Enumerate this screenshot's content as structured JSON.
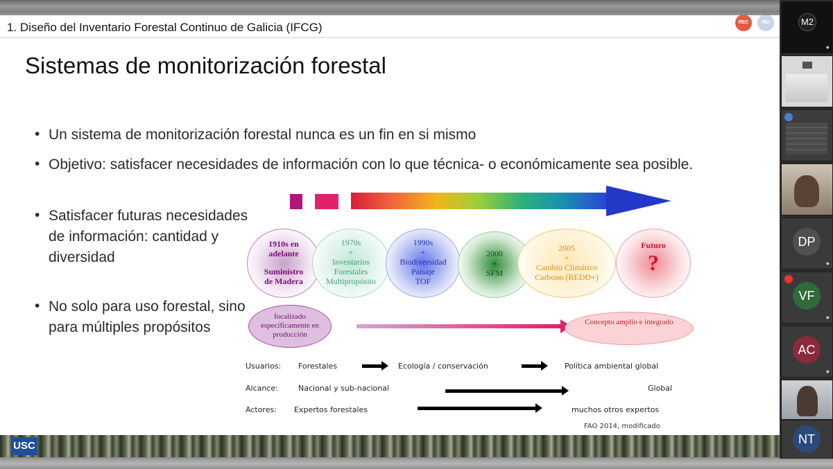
{
  "header": {
    "title": "1. Diseño del Inventario Forestal Continuo de Galicia (IFCG)",
    "rec_badge": "REC",
    "user_badge": "RD"
  },
  "slide": {
    "title": "Sistemas de monitorización forestal",
    "bullets": [
      "Un sistema de monitorización forestal nunca es un fin en si mismo",
      "Objetivo: satisfacer necesidades de información con lo que técnica- o económicamente sea posible.",
      "Satisfacer futuras necesidades de información: cantidad y diversidad",
      "No solo para uso forestal, sino para múltiples propósitos"
    ],
    "circles": [
      {
        "line1": "1910s en",
        "line2": "adelante",
        "line3": "Suministro",
        "line4": "de Madera",
        "color": "#8b1a8b"
      },
      {
        "line1": "1970s",
        "line2": "+",
        "line3": "Inventarios",
        "line4": "Forestales",
        "line5": "Multipropósito",
        "color": "#7fc9a8"
      },
      {
        "line1": "1990s",
        "line2": "+",
        "line3": "Biodiversidad",
        "line4": "Paisaje",
        "line5": "TOF",
        "color": "#2a3fd6"
      },
      {
        "line1": "2000",
        "line2": "+",
        "line3": "SFM",
        "color": "#1f7a2a"
      },
      {
        "line1": "2005",
        "line2": "+",
        "line3": "Cambio Climático",
        "line4": "Carbono (REDD+)",
        "color": "#e6a21a"
      },
      {
        "line1": "Futuro",
        "line2": "?",
        "color": "#d1202f"
      }
    ],
    "focus_left": "focalizado específicamente en producción",
    "focus_right": "Concepto amplio e integrado",
    "rows": [
      {
        "label": "Usuarios:",
        "a": "Forestales",
        "b": "Ecología / conservación",
        "c": "Política ambiental global"
      },
      {
        "label": "Alcance:",
        "a": "Nacional y sub-nacional",
        "c": "Global"
      },
      {
        "label": "Actores:",
        "a": "Expertos forestales",
        "c": "muchos otros expertos"
      }
    ],
    "source": "FAO 2014, modificado",
    "logo": "USC"
  },
  "participants": [
    {
      "initials": "M2",
      "type": "avatar",
      "color": "#1f1f1f"
    },
    {
      "initials": "",
      "type": "screen"
    },
    {
      "initials": "",
      "type": "screen2"
    },
    {
      "initials": "",
      "type": "video"
    },
    {
      "initials": "DP",
      "type": "avatar",
      "color": "#505050"
    },
    {
      "initials": "VF",
      "type": "avatar",
      "color": "#2f6b3a"
    },
    {
      "initials": "AC",
      "type": "avatar",
      "color": "#8a2a3c"
    },
    {
      "initials": "",
      "type": "video2"
    },
    {
      "initials": "NT",
      "type": "avatar",
      "color": "#2b4a7a"
    }
  ]
}
